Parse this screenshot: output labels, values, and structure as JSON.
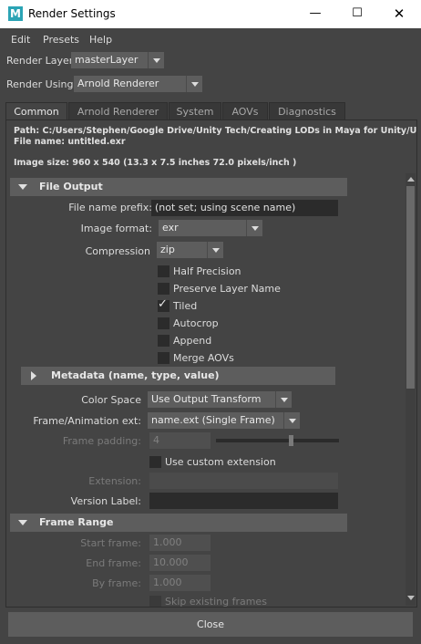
{
  "window": {
    "app_icon_letter": "M",
    "title": "Render Settings",
    "minimize_glyph": "—",
    "maximize_glyph": "☐",
    "close_glyph": "✕"
  },
  "menu": [
    "Edit",
    "Presets",
    "Help"
  ],
  "render_layer": {
    "label": "Render Layer",
    "value": "masterLayer"
  },
  "render_using": {
    "label": "Render Using",
    "value": "Arnold Renderer"
  },
  "tabs": [
    "Common",
    "Arnold Renderer",
    "System",
    "AOVs",
    "Diagnostics"
  ],
  "active_tab": "Common",
  "info": {
    "path": "Path: C:/Users/Stephen/Google Drive/Unity Tech/Creating LODs in Maya for Unity/Unity_LOD_M",
    "file_name": "File name:  untitled.exr",
    "image_size": "Image size: 960 x 540 (13.3 x 7.5 inches 72.0 pixels/inch )"
  },
  "file_output": {
    "header": "File Output",
    "prefix_label": "File name prefix:",
    "prefix_value": "(not set; using scene name)",
    "format_label": "Image format:",
    "format_value": "exr",
    "compression_label": "Compression",
    "compression_value": "zip",
    "checkboxes": [
      {
        "label": "Half Precision",
        "checked": false
      },
      {
        "label": "Preserve Layer Name",
        "checked": false
      },
      {
        "label": "Tiled",
        "checked": true
      },
      {
        "label": "Autocrop",
        "checked": false
      },
      {
        "label": "Append",
        "checked": false
      },
      {
        "label": "Merge AOVs",
        "checked": false
      }
    ],
    "metadata_header": "Metadata (name, type, value)",
    "color_space_label": "Color Space",
    "color_space_value": "Use Output Transform",
    "frame_ext_label": "Frame/Animation ext:",
    "frame_ext_value": "name.ext (Single Frame)",
    "padding_label": "Frame padding:",
    "padding_value": "4",
    "padding_slider_fraction": 0.61,
    "custom_ext_label": "Use custom extension",
    "extension_label": "Extension:",
    "extension_value": "",
    "version_label": "Version Label:",
    "version_value": ""
  },
  "frame_range": {
    "header": "Frame Range",
    "start_label": "Start frame:",
    "start_value": "1.000",
    "end_label": "End frame:",
    "end_value": "10.000",
    "by_label": "By frame:",
    "by_value": "1.000",
    "skip_label": "Skip existing frames"
  },
  "close_label": "Close",
  "colors": {
    "background": "#444444",
    "header_bg": "#5d5d5d",
    "field_bg": "#2b2b2b",
    "maya_icon": "#2ba4b5"
  }
}
